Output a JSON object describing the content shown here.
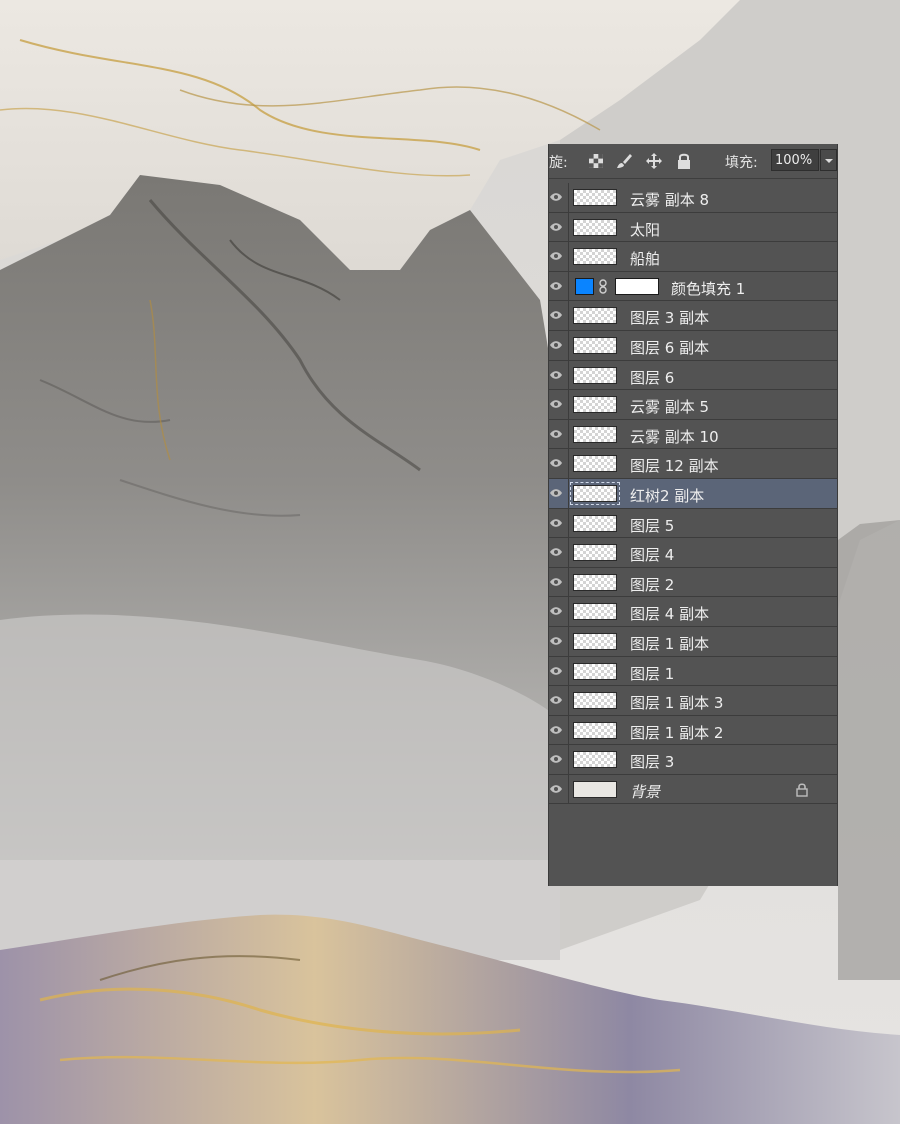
{
  "colors": {
    "panel_bg": "#535353",
    "row_selected": "#5b6578",
    "fill_swatch": "#0a84ff",
    "text": "#eeeeee"
  },
  "lock_bar": {
    "label": "旋:",
    "icons": [
      "lock-transparent-icon",
      "lock-paint-icon",
      "lock-move-icon",
      "lock-all-icon"
    ],
    "fill_label": "填充:",
    "fill_value": "100%"
  },
  "layers": [
    {
      "name": "云雾 副本 8"
    },
    {
      "name": "太阳"
    },
    {
      "name": "船舶"
    },
    {
      "name": "颜色填充 1",
      "type": "fill"
    },
    {
      "name": "图层 3 副本"
    },
    {
      "name": "图层 6 副本"
    },
    {
      "name": "图层 6"
    },
    {
      "name": "云雾 副本 5"
    },
    {
      "name": "云雾 副本 10"
    },
    {
      "name": "图层 12 副本"
    },
    {
      "name": "红树2 副本",
      "selected": true
    },
    {
      "name": "图层 5"
    },
    {
      "name": "图层 4"
    },
    {
      "name": "图层 2"
    },
    {
      "name": "图层 4 副本"
    },
    {
      "name": "图层 1 副本"
    },
    {
      "name": "图层 1"
    },
    {
      "name": "图层 1 副本 3"
    },
    {
      "name": "图层 1 副本 2"
    },
    {
      "name": "图层 3"
    },
    {
      "name": "背景",
      "type": "background",
      "locked": true
    }
  ]
}
